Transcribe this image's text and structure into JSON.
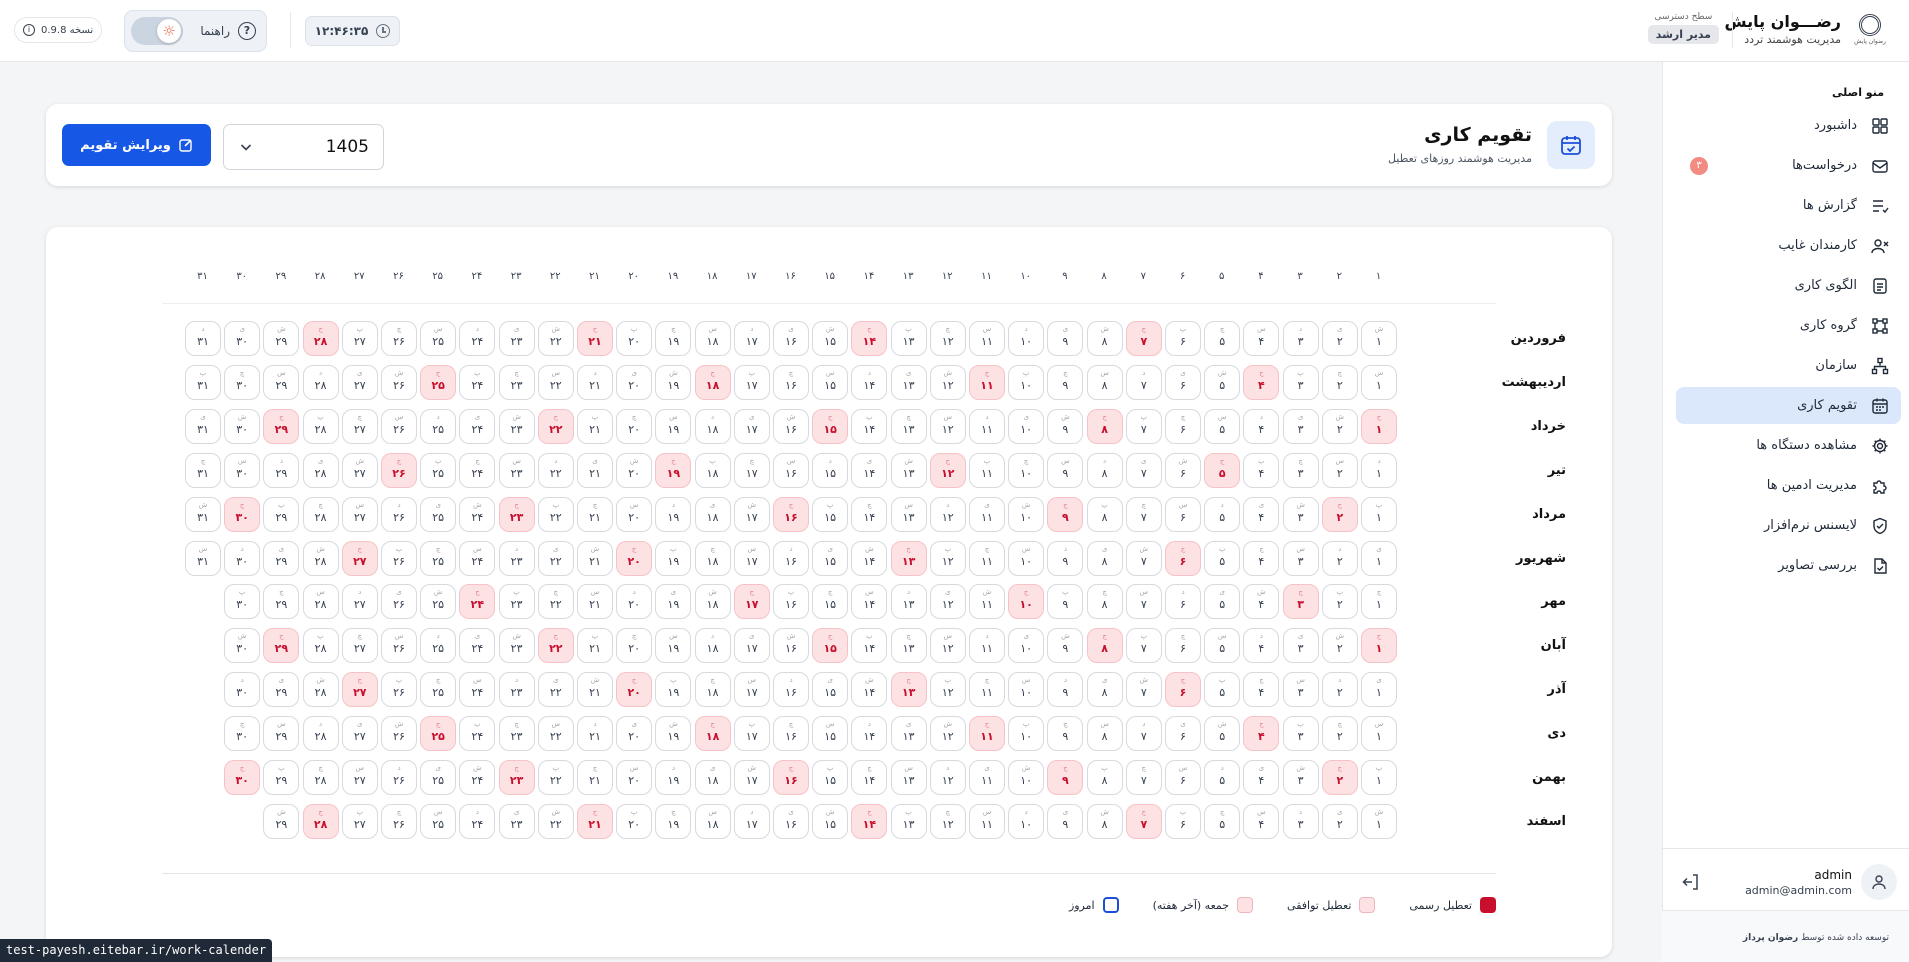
{
  "brand": {
    "title": "رضـــوان پایش",
    "subtitle": "مدیریت هوشمند تردد",
    "logo_text": "رضوان پایش"
  },
  "access": {
    "label": "سطح دسترسی",
    "role": "مدیر ارشد"
  },
  "clock": {
    "time": "۱۲:۴۶:۳۵"
  },
  "help": {
    "label": "راهنما",
    "icon": "question-circle-icon"
  },
  "theme_toggle": {
    "icon": "sun-icon",
    "state": "light"
  },
  "version": {
    "label": "نسخه 0.9.8"
  },
  "sidebar": {
    "title": "منو اصلی",
    "items": [
      {
        "label": "داشبورد",
        "icon": "dashboard-icon"
      },
      {
        "label": "درخواست‌ها",
        "icon": "mail-icon",
        "badge": "۳"
      },
      {
        "label": "گزارش ها",
        "icon": "list-check-icon"
      },
      {
        "label": "کارمندان غایب",
        "icon": "user-x-icon"
      },
      {
        "label": "الگوی کاری",
        "icon": "document-icon"
      },
      {
        "label": "گروه کاری",
        "icon": "group-icon"
      },
      {
        "label": "سازمان",
        "icon": "org-icon"
      },
      {
        "label": "تقویم کاری",
        "icon": "calendar-icon",
        "active": true
      },
      {
        "label": "مشاهده دستگاه ها",
        "icon": "gear-icon"
      },
      {
        "label": "مدیریت ادمین ها",
        "icon": "puzzle-icon"
      },
      {
        "label": "لایسنس نرم‌افزار",
        "icon": "shield-icon"
      },
      {
        "label": "بررسی تصاویر",
        "icon": "image-check-icon"
      }
    ]
  },
  "user": {
    "name": "admin",
    "email": "admin@admin.com"
  },
  "footer": {
    "prefix": "توسعه داده شده توسط",
    "company": "رضوان پرداز"
  },
  "page": {
    "title": "تقویم کاری",
    "subtitle": "مدیریت هوشمند روزهای تعطیل"
  },
  "year_select": {
    "value": "1405"
  },
  "edit_button": {
    "label": "ویرایش تقویم"
  },
  "accent_color": "#1657e5",
  "holiday_color": "#c8102e",
  "calendar": {
    "day_headers": [
      "۱",
      "۲",
      "۳",
      "۴",
      "۵",
      "۶",
      "۷",
      "۸",
      "۹",
      "۱۰",
      "۱۱",
      "۱۲",
      "۱۳",
      "۱۴",
      "۱۵",
      "۱۶",
      "۱۷",
      "۱۸",
      "۱۹",
      "۲۰",
      "۲۱",
      "۲۲",
      "۲۳",
      "۲۴",
      "۲۵",
      "۲۶",
      "۲۷",
      "۲۸",
      "۲۹",
      "۳۰",
      "۳۱"
    ],
    "months": [
      {
        "name": "فروردین",
        "days": 31,
        "start": 0,
        "holidays": [
          7,
          14,
          21,
          28
        ]
      },
      {
        "name": "اردیبهشت",
        "days": 31,
        "start": 3,
        "holidays": [
          4,
          11,
          18,
          25
        ]
      },
      {
        "name": "خرداد",
        "days": 31,
        "start": 6,
        "holidays": [
          1,
          8,
          15,
          22,
          29
        ]
      },
      {
        "name": "تیر",
        "days": 31,
        "start": 2,
        "holidays": [
          5,
          12,
          19,
          26
        ]
      },
      {
        "name": "مرداد",
        "days": 31,
        "start": 5,
        "holidays": [
          2,
          9,
          16,
          23,
          30
        ]
      },
      {
        "name": "شهریور",
        "days": 31,
        "start": 1,
        "holidays": [
          6,
          13,
          20,
          27
        ]
      },
      {
        "name": "مهر",
        "days": 30,
        "start": 4,
        "holidays": [
          3,
          10,
          17,
          24
        ]
      },
      {
        "name": "آبان",
        "days": 30,
        "start": 6,
        "holidays": [
          1,
          8,
          15,
          22,
          29
        ]
      },
      {
        "name": "آذر",
        "days": 30,
        "start": 1,
        "holidays": [
          6,
          13,
          20,
          27
        ]
      },
      {
        "name": "دی",
        "days": 30,
        "start": 3,
        "holidays": [
          4,
          11,
          18,
          25
        ]
      },
      {
        "name": "بهمن",
        "days": 30,
        "start": 5,
        "holidays": [
          2,
          9,
          16,
          23,
          30
        ]
      },
      {
        "name": "اسفند",
        "days": 29,
        "start": 0,
        "holidays": [
          7,
          14,
          21,
          28
        ]
      }
    ],
    "weekday_letters": [
      "ش",
      "ی",
      "د",
      "س",
      "چ",
      "پ",
      "ج"
    ]
  },
  "legend": {
    "official": "تعطیل رسمی",
    "agreed": "تعطیل توافقی",
    "friday": "جمعه (آخر هفته)",
    "today": "امروز"
  },
  "status_url": "test-payesh.eitebar.ir/work-calender"
}
